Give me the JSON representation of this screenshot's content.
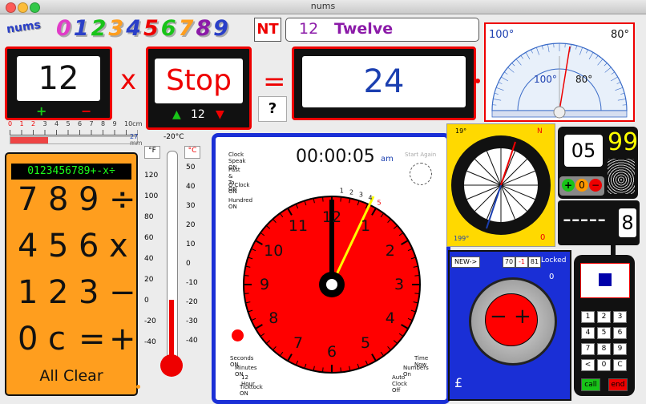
{
  "window": {
    "title": "nums"
  },
  "header": {
    "logo_word": "nums",
    "digits": [
      "0",
      "1",
      "2",
      "3",
      "4",
      "5",
      "6",
      "7",
      "8",
      "9"
    ],
    "logo_badge": "NT",
    "number_display": {
      "value": "12",
      "word": "Twelve"
    }
  },
  "equation": {
    "left_value": "12",
    "operator": "x",
    "middle_value": "Stop",
    "equals": "=",
    "result": "24",
    "question": "?",
    "middle_step": "12"
  },
  "protractor": {
    "left_deg": "100°",
    "right_deg": "80°",
    "inner_left": "100°",
    "inner_right": "80°"
  },
  "ruler": {
    "labels": [
      "0",
      "1",
      "2",
      "3",
      "4",
      "5",
      "6",
      "7",
      "8",
      "9",
      "10cm"
    ],
    "mm_top": "27",
    "mm_bottom": "mm"
  },
  "calculator": {
    "display": "0123456789+-x÷",
    "rows": [
      [
        "7",
        "8",
        "9",
        "÷"
      ],
      [
        "4",
        "5",
        "6",
        "x"
      ],
      [
        "1",
        "2",
        "3",
        "−"
      ],
      [
        "0",
        "c",
        "=",
        "+"
      ]
    ],
    "clear_label": "All Clear"
  },
  "thermometer": {
    "top_label": "-20°C",
    "f_label": "°F",
    "c_label": "°C",
    "f_ticks": [
      "120",
      "100",
      "80",
      "60",
      "40",
      "20",
      "0",
      "-20",
      "-40"
    ],
    "c_ticks": [
      "50",
      "40",
      "30",
      "20",
      "10",
      "0",
      "-10",
      "-20",
      "-30",
      "-40"
    ]
  },
  "clock": {
    "time": "00:00:05",
    "ampm": "am",
    "start_again": "Start Again",
    "options_left": [
      "Clock Speak ON",
      "Past & To ON",
      "O'Clock ON",
      "Hundred ON"
    ],
    "options_bottom_left": [
      "Seconds ON",
      "Minutes ON",
      "12 Hour",
      "Ticktock ON"
    ],
    "options_bottom_right": [
      "Time Now",
      "Numbers On",
      "Auto Clock Off"
    ],
    "numbers": [
      "12",
      "1",
      "2",
      "3",
      "4",
      "5",
      "6",
      "7",
      "8",
      "9",
      "10",
      "11"
    ],
    "sec_ticks": [
      "1",
      "2",
      "3",
      "4",
      "5"
    ]
  },
  "compass": {
    "top_left": "19°",
    "bottom_left": "199°",
    "n_label": "N",
    "zero": "0"
  },
  "counter": {
    "value": "05",
    "score": "99"
  },
  "dashes": {
    "text": "-----",
    "value": "8"
  },
  "lock": {
    "new_btn": "NEW->",
    "codes": [
      "70",
      "-1",
      "81"
    ],
    "status": "Locked",
    "dial_value": "0",
    "minus": "−",
    "plus": "+",
    "currency": "£"
  },
  "phone": {
    "keys": [
      [
        "1",
        "2",
        "3"
      ],
      [
        "4",
        "5",
        "6"
      ],
      [
        "7",
        "8",
        "9"
      ],
      [
        "<",
        "0",
        "C"
      ]
    ],
    "call": "call",
    "end": "end"
  }
}
